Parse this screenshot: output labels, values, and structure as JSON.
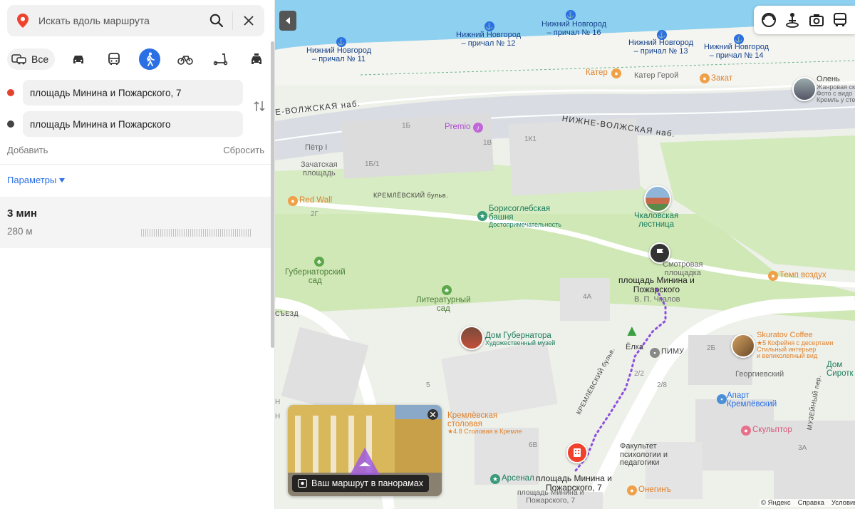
{
  "search": {
    "placeholder": "Искать вдоль маршрута"
  },
  "modes": {
    "all_label": "Все"
  },
  "route_points": {
    "from": "площадь Минина и Пожарского, 7",
    "to": "площадь Минина и Пожарского"
  },
  "actions": {
    "add": "Добавить",
    "reset": "Сбросить",
    "params": "Параметры"
  },
  "route": {
    "time": "3 мин",
    "distance": "280 м"
  },
  "map": {
    "piers": [
      {
        "city": "Нижний Новгород",
        "pier": "– причал № 11"
      },
      {
        "city": "Нижний Новгород",
        "pier": "– причал № 12"
      },
      {
        "city": "Нижний Новгород",
        "pier": "– причал № 16"
      },
      {
        "city": "Нижний Новгород",
        "pier": "– причал № 13"
      },
      {
        "city": "Нижний Новгород",
        "pier": "– причал № 14"
      }
    ],
    "streets": {
      "volga_left": "Е-ВОЛЖСКАЯ наб.",
      "volga_right": "НИЖНЕ-ВОЛЖСКАЯ наб.",
      "kreml_blvd": "КРЕМЛЁВСКИЙ бульв.",
      "kreml_blvd_2": "КРЕМЛЁВСКИЙ бульв.",
      "sezd": "СЪЕЗД",
      "muzeyny": "МУЗЕЙНЫЙ пер.",
      "chkalov": "В. П. Чкалов"
    },
    "houses": [
      "1Б",
      "1В",
      "1К1",
      "1Б/1",
      "2Г",
      "4А",
      "5",
      "6В",
      "2/8",
      "2/2",
      "2Б",
      "3А",
      "Н",
      "Н"
    ],
    "places": {
      "petr": "Пётр I",
      "zachatskaya_1": "Зачатская",
      "zachatskaya_2": "площадь",
      "kater_geroy": "Катер Герой",
      "georgievsky": "Георгиевский",
      "olen_1": "Олень",
      "olen_2": "Жанровая ск",
      "olen_3": "Фото с видо",
      "olen_4": "Кремль у стен"
    },
    "poi": {
      "kater": "Катер",
      "zakat": "Закат",
      "premio": "Premio",
      "red_wall": "Red Wall",
      "boris_1": "Борисоглебская",
      "boris_2": "башня",
      "boris_sub": "Достопримечательность",
      "chkalov_1": "Чкаловская",
      "chkalov_2": "лестница",
      "smotr_1": "Смотровая",
      "smotr_2": "площадка",
      "gub_sad_1": "Губернаторский",
      "gub_sad_2": "сад",
      "lit_sad_1": "Литературный",
      "lit_sad_2": "сад",
      "dom_gub": "Дом Губернатора",
      "dom_gub_sub": "Художественный музей",
      "elka": "Ёлка",
      "pimu": "ПИМУ",
      "skuratov": "Skuratov Coffee",
      "skuratov_sub1": "★5 Кофейня с десертами",
      "skuratov_sub2": "Стильный интерьер",
      "skuratov_sub3": "и великолепный вид",
      "temp": "Темп воздух",
      "stolovaya_1": "Кремлёвская",
      "stolovaya_2": "столовая",
      "stolovaya_sub": "★4.8 Столовая в Кремле",
      "apart_1": "Апарт",
      "apart_2": "Кремлёвский",
      "sculptor": "Скульптор",
      "fakultet_1": "Факультет",
      "fakultet_2": "психологии и",
      "fakultet_3": "педагогики",
      "arsenal": "Арсенал",
      "onegin": "Онегинъ",
      "dom_sirot_1": "Дом",
      "dom_sirot_2": "Сиротк",
      "ploshchad_end_1": "площадь Минина и",
      "ploshchad_end_2": "Пожарского, 7",
      "ploshchad_mid_1": "площадь Минина и",
      "ploshchad_mid_2": "Пожарского",
      "arsenal_sq_1": "площадь Минина и",
      "arsenal_sq_2": "Пожарского, 7"
    },
    "panorama": {
      "caption": "Ваш маршрут в панорамах"
    },
    "attribution": {
      "yandex": "© Яндекс",
      "help": "Справка",
      "terms": "Условия"
    }
  },
  "colors": {
    "accent": "#2a6fe4",
    "water": "#8ed0ef",
    "park": "#cfe8b6",
    "route": "#8c4ee0",
    "start": "#e5412f"
  }
}
